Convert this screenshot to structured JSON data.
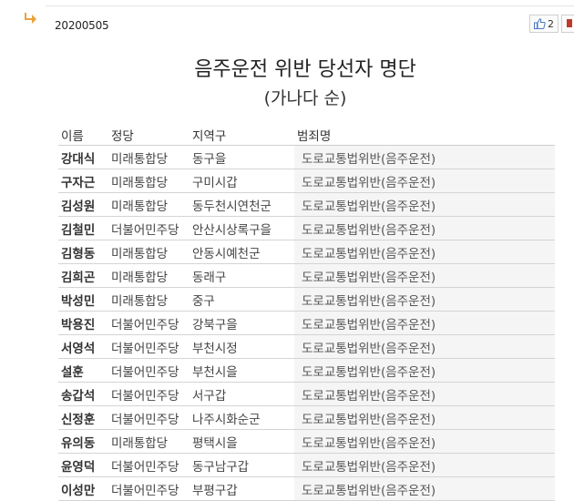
{
  "post": {
    "date": "20200505",
    "like_count": "2",
    "title": "음주운전 위반 당선자 명단",
    "subtitle": "(가나다 순)"
  },
  "table": {
    "headers": [
      "이름",
      "정당",
      "지역구",
      "범죄명"
    ],
    "rows": [
      [
        "강대식",
        "미래통합당",
        "동구을",
        "도로교통법위반(음주운전)"
      ],
      [
        "구자근",
        "미래통합당",
        "구미시갑",
        "도로교통법위반(음주운전)"
      ],
      [
        "김성원",
        "미래통합당",
        "동두천시연천군",
        "도로교통법위반(음주운전)"
      ],
      [
        "김철민",
        "더불어민주당",
        "안산시상록구을",
        "도로교통법위반(음주운전)"
      ],
      [
        "김형동",
        "미래통합당",
        "안동시예천군",
        "도로교통법위반(음주운전)"
      ],
      [
        "김희곤",
        "미래통합당",
        "동래구",
        "도로교통법위반(음주운전)"
      ],
      [
        "박성민",
        "미래통합당",
        "중구",
        "도로교통법위반(음주운전)"
      ],
      [
        "박용진",
        "더불어민주당",
        "강북구을",
        "도로교통법위반(음주운전)"
      ],
      [
        "서영석",
        "더불어민주당",
        "부천시정",
        "도로교통법위반(음주운전)"
      ],
      [
        "설훈",
        "더불어민주당",
        "부천시을",
        "도로교통법위반(음주운전)"
      ],
      [
        "송갑석",
        "더불어민주당",
        "서구갑",
        "도로교통법위반(음주운전)"
      ],
      [
        "신정훈",
        "더불어민주당",
        "나주시화순군",
        "도로교통법위반(음주운전)"
      ],
      [
        "유의동",
        "미래통합당",
        "평택시을",
        "도로교통법위반(음주운전)"
      ],
      [
        "윤영덕",
        "더불어민주당",
        "동구남구갑",
        "도로교통법위반(음주운전)"
      ],
      [
        "이성만",
        "더불어민주당",
        "부평구갑",
        "도로교통법위반(음주운전)"
      ]
    ]
  },
  "icons": {
    "reply": "reply-arrow-icon",
    "like": "thumbs-up-icon",
    "report": "flag-icon"
  },
  "colors": {
    "reply_arrow": "#e8a33a",
    "like_icon": "#4a78c2",
    "report_flag": "#c0392b"
  }
}
